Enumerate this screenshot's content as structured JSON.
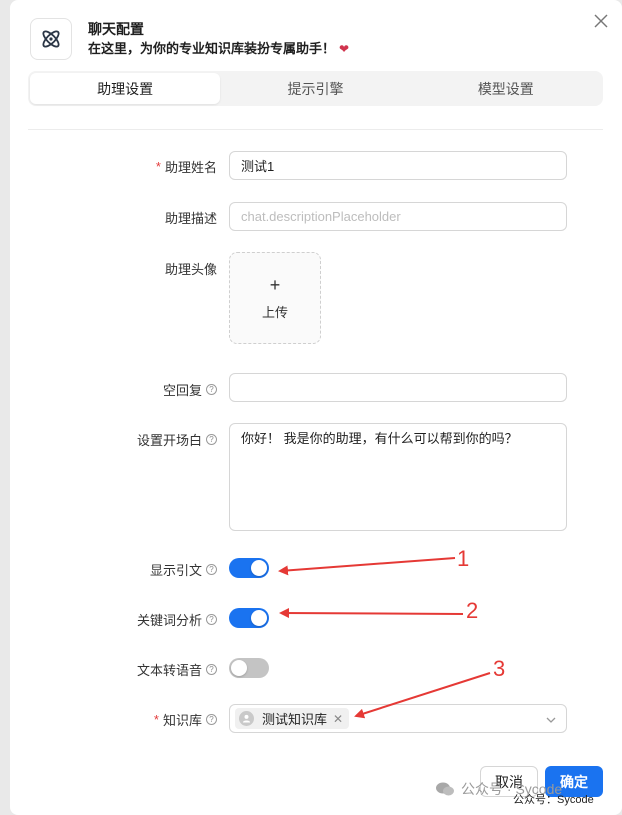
{
  "dialog": {
    "title": "聊天配置",
    "subtitle": "在这里，为你的专业知识库装扮专属助手！",
    "heart_icon": "heart-icon",
    "logo_icon": "atom-icon",
    "close_icon": "close-icon"
  },
  "tabs": [
    {
      "label": "助理设置",
      "active": true
    },
    {
      "label": "提示引擎",
      "active": false
    },
    {
      "label": "模型设置",
      "active": false
    }
  ],
  "form": {
    "name": {
      "label": "助理姓名",
      "required": true,
      "value": "测试1"
    },
    "description": {
      "label": "助理描述",
      "value": "",
      "placeholder": "chat.descriptionPlaceholder"
    },
    "avatar": {
      "label": "助理头像",
      "upload_plus": "+",
      "upload_label": "上传"
    },
    "empty_reply": {
      "label": "空回复",
      "value": ""
    },
    "opening": {
      "label": "设置开场白",
      "value": "你好！ 我是你的助理，有什么可以帮到你的吗？"
    },
    "show_citation": {
      "label": "显示引文",
      "on": true
    },
    "keyword_analysis": {
      "label": "关键词分析",
      "on": true
    },
    "tts": {
      "label": "文本转语音",
      "on": false
    },
    "knowledge_base": {
      "label": "知识库",
      "required": true,
      "selected": [
        "测试知识库"
      ]
    }
  },
  "footer": {
    "cancel_label": "取消",
    "ok_label": "确定"
  },
  "watermark": {
    "text": "公众号 · Sycode",
    "small_text": "公众号：Sycode"
  },
  "annotations": {
    "color": "#e53935",
    "numbers": [
      "1",
      "2",
      "3"
    ]
  },
  "colors": {
    "primary": "#1a73f0",
    "required": "#e33b3b"
  }
}
